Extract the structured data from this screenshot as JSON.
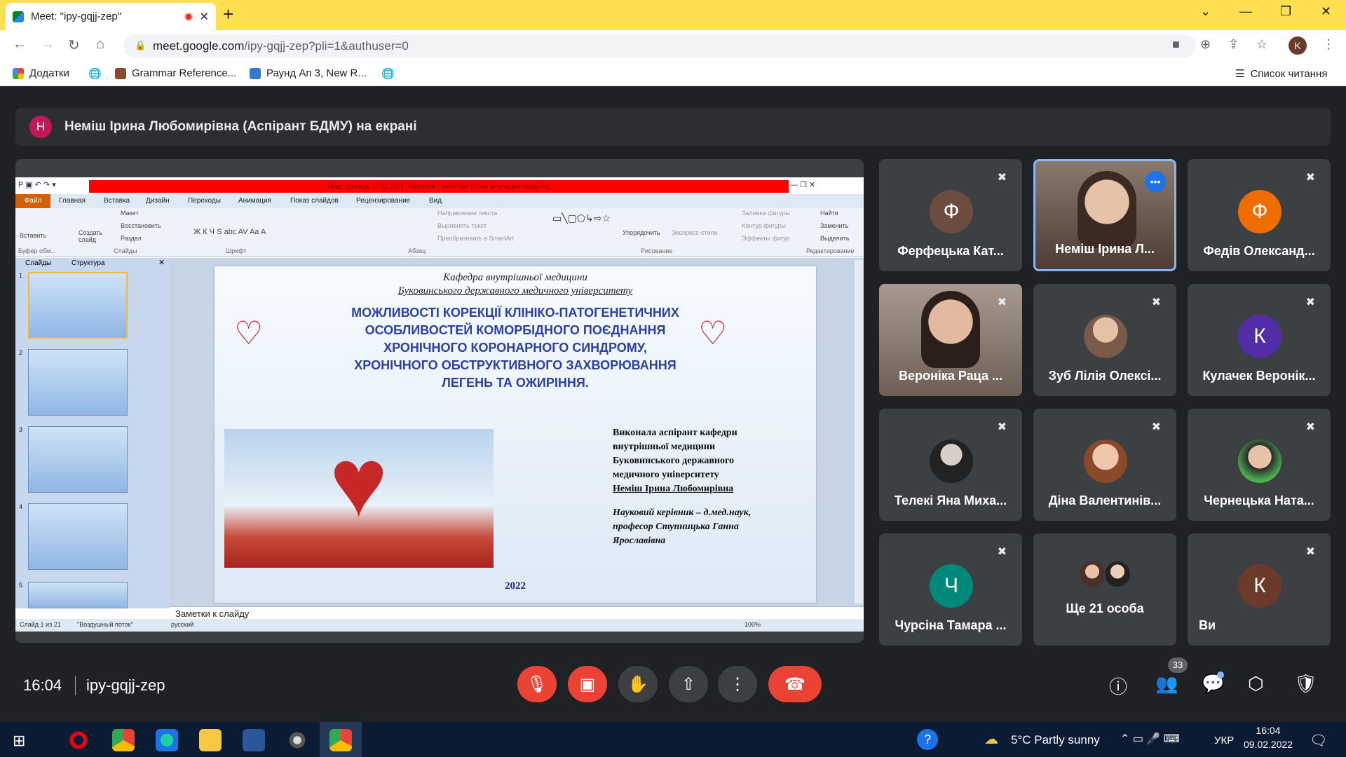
{
  "browser": {
    "tab_title": "Meet: \"ipy-gqjj-zep\"",
    "new_tab": "+",
    "url_host": "meet.google.com",
    "url_path": "/ipy-gqjj-zep?pli=1&authuser=0",
    "profile_initial": "K",
    "bookmarks": [
      "Додатки",
      "Grammar Reference...",
      "Раунд Ап 3, New R..."
    ],
    "reading_list": "Список читання",
    "colors": {
      "tabbar": "#fedf4f"
    }
  },
  "meet": {
    "presenter_initial": "Н",
    "presenting_text": "Неміш Ірина Любомирівна (Аспірант БДМУ) на екрані",
    "time": "16:04",
    "meeting_code": "ipy-gqjj-zep",
    "participants_count": "33",
    "tiles": [
      {
        "name": "Ферфецька Кат...",
        "initial": "Ф",
        "color": "#6d4c41",
        "muted": true
      },
      {
        "name": "Неміш Ірина Л...",
        "video": true,
        "active": true
      },
      {
        "name": "Федів Олександ...",
        "initial": "Ф",
        "color": "#ef6c00",
        "muted": true
      },
      {
        "name": "Вероніка Раца ...",
        "video": true,
        "muted": true
      },
      {
        "name": "Зуб Лілія Олексі...",
        "photo": true,
        "muted": true
      },
      {
        "name": "Кулачек Веронік...",
        "initial": "К",
        "color": "#512da8",
        "muted": true
      },
      {
        "name": "Телекі Яна Миха...",
        "photo": true,
        "muted": true
      },
      {
        "name": "Діна Валентинів...",
        "photo": true,
        "muted": true
      },
      {
        "name": "Чернецька Ната...",
        "photo": true,
        "muted": true
      },
      {
        "name": "Чурсіна Тамара ...",
        "initial": "Ч",
        "color": "#00897b",
        "muted": true
      },
      {
        "name": "Ще 21 особа",
        "group": true
      },
      {
        "name": "Ви",
        "initial": "К",
        "color": "#6b3a2a",
        "muted": true
      }
    ]
  },
  "ppt": {
    "title": "Нова доповідь 17.01.2022 - Microsoft PowerPoint (Сбой активации продукта)",
    "tabs": [
      "Файл",
      "Главная",
      "Вставка",
      "Дизайн",
      "Переходы",
      "Анимация",
      "Показ слайдов",
      "Рецензирование",
      "Вид"
    ],
    "groups": [
      "Буфер обм...",
      "Слайды",
      "Шрифт",
      "Абзац",
      "Рисование",
      "Редактирование"
    ],
    "ribbon_items": [
      "Вставить",
      "Создать слайд",
      "Макет",
      "Восстановить",
      "Раздел",
      "Направление текста",
      "Выровнять текст",
      "Преобразовать в SmartArt",
      "Упорядочить",
      "Экспресс-стили",
      "Заливка фигуры",
      "Контур фигуры",
      "Эффекты фигур",
      "Найти",
      "Заменить",
      "Выделить"
    ],
    "panel_tabs": [
      "Слайды",
      "Структура"
    ],
    "slide_numbers": [
      "1",
      "2",
      "3",
      "4",
      "5"
    ],
    "notes": "Заметки к слайду",
    "status": [
      "Слайд 1 из 21",
      "\"Воздушный поток\"",
      "русский",
      "100%"
    ]
  },
  "slide": {
    "dept1": "Кафедра внутрішньої медицини",
    "dept2": "Буковинського державного медичного університету",
    "title": [
      "МОЖЛИВОСТІ КОРЕКЦІЇ КЛІНІКО-ПАТОГЕНЕТИЧНИХ",
      "ОСОБЛИВОСТЕЙ КОМОРБІДНОГО ПОЄДНАННЯ",
      "ХРОНІЧНОГО КОРОНАРНОГО СИНДРОМУ,",
      "ХРОНІЧНОГО ОБСТРУКТИВНОГО ЗАХВОРЮВАННЯ",
      "ЛЕГЕНЬ ТА ОЖИРІННЯ."
    ],
    "author": [
      "Виконала аспірант кафедри",
      "внутрішньої медицини",
      "Буковинського державного",
      "медичного університету",
      "Неміш Ірина Любомирівна"
    ],
    "supervisor": [
      "Науковий керівник – д.мед.наук,",
      "професор Ступницька Ганна",
      "Ярославівна"
    ],
    "year": "2022"
  },
  "taskbar": {
    "weather": "5°C  Partly sunny",
    "lang": "УКР",
    "time": "16:04",
    "date": "09.02.2022"
  }
}
